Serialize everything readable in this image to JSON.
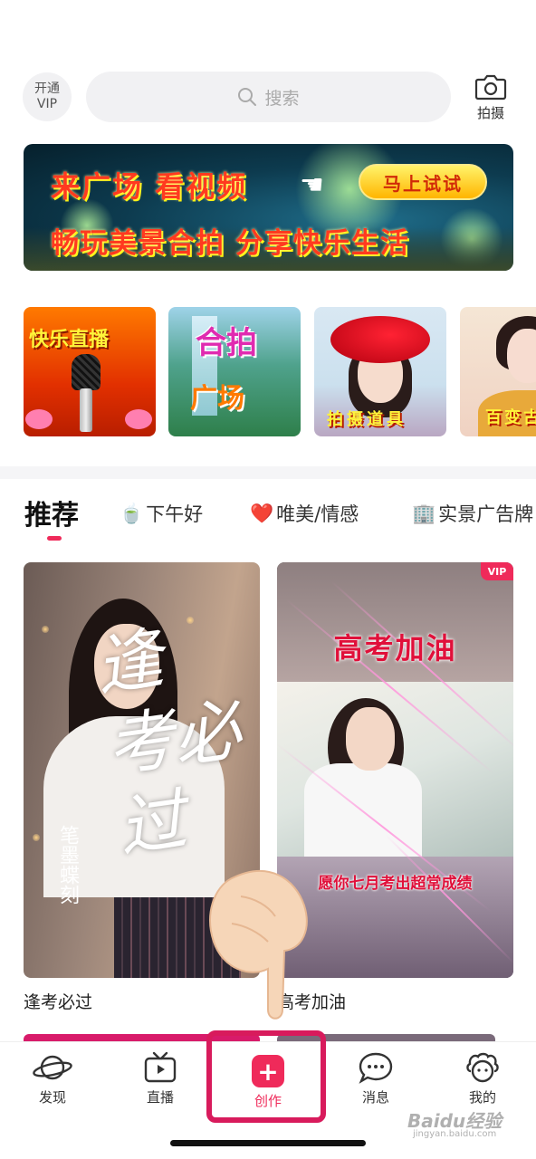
{
  "header": {
    "vip_line1": "开通",
    "vip_line2": "VIP",
    "search_placeholder": "搜索",
    "camera_label": "拍摄"
  },
  "banner": {
    "line1": "来广场 看视频",
    "line2": "畅玩美景合拍 分享快乐生活",
    "button": "马上试试"
  },
  "categories": [
    {
      "label": "快乐直播"
    },
    {
      "label_top": "合拍",
      "label_bottom": "广场"
    },
    {
      "label": "拍摄道具"
    },
    {
      "label": "百变古"
    }
  ],
  "tabs": [
    {
      "label": "推荐",
      "icon": ""
    },
    {
      "label": "下午好",
      "icon": "🍵"
    },
    {
      "label": "唯美/情感",
      "icon": "❤️"
    },
    {
      "label": "实景广告牌",
      "icon": "🏢"
    }
  ],
  "videos": [
    {
      "title": "逢考必过",
      "calligraphy": [
        "逢",
        "考必",
        "过"
      ],
      "signature": "笔墨蝶刻"
    },
    {
      "title": "高考加油",
      "overlay_title": "高考加油",
      "overlay_sub": "愿你七月考出超常成绩",
      "badge": "VIP"
    }
  ],
  "nav": [
    {
      "label": "发现",
      "icon": "planet-icon"
    },
    {
      "label": "直播",
      "icon": "tv-icon"
    },
    {
      "label": "创作",
      "icon": "plus-icon"
    },
    {
      "label": "消息",
      "icon": "chat-icon"
    },
    {
      "label": "我的",
      "icon": "profile-icon"
    }
  ],
  "watermark": {
    "text": "Baidu经验",
    "sub": "jingyan.baidu.com"
  },
  "colors": {
    "accent": "#ef2a5a",
    "highlight": "#d81b5c"
  }
}
